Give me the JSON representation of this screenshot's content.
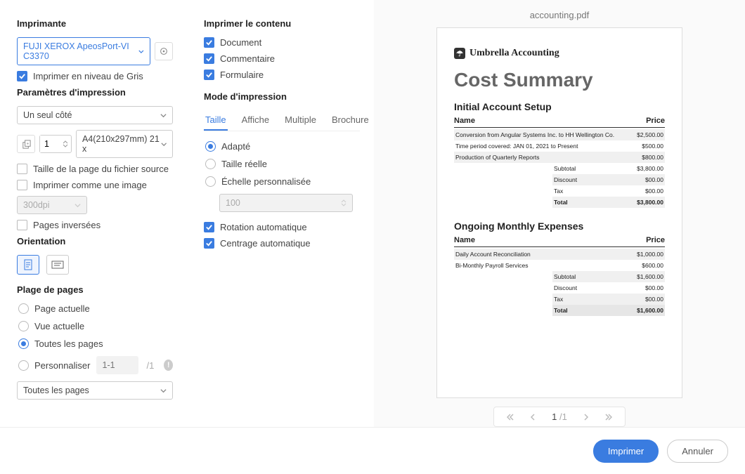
{
  "col1": {
    "printer_title": "Imprimante",
    "printer_value": "FUJI XEROX ApeosPort-VI C3370",
    "grayscale": "Imprimer en niveau de Gris",
    "settings_title": "Paramètres d'impression",
    "duplex_value": "Un seul côté",
    "copies_value": "1",
    "paper_value": "A4(210x297mm) 21 x",
    "source_page_size": "Taille de la page du fichier source",
    "print_as_image": "Imprimer comme une image",
    "dpi_value": "300dpi",
    "reverse_pages": "Pages inversées",
    "orientation_title": "Orientation",
    "range_title": "Plage de pages",
    "range_current_page": "Page actuelle",
    "range_current_view": "Vue actuelle",
    "range_all": "Toutes les pages",
    "range_custom": "Personnaliser",
    "range_custom_placeholder": "1-1",
    "range_total": "/1",
    "page_subset": "Toutes les pages"
  },
  "col2": {
    "content_title": "Imprimer le contenu",
    "opt_document": "Document",
    "opt_comment": "Commentaire",
    "opt_form": "Formulaire",
    "mode_title": "Mode d'impression",
    "tabs": {
      "size": "Taille",
      "poster": "Affiche",
      "multiple": "Multiple",
      "brochure": "Brochure"
    },
    "fit": "Adapté",
    "actual": "Taille réelle",
    "custom_scale": "Échelle personnalisée",
    "scale_value": "100",
    "auto_rotate": "Rotation automatique",
    "auto_center": "Centrage automatique"
  },
  "preview": {
    "filename": "accounting.pdf",
    "logo_text": "Umbrella Accounting",
    "h1": "Cost Summary",
    "sec1_title": "Initial Account Setup",
    "name_hdr": "Name",
    "price_hdr": "Price",
    "s1r1_name": "Conversion from Angular Systems Inc. to HH Wellington Co.",
    "s1r1_price": "$2,500.00",
    "s1r2_name": "Time period covered: JAN 01, 2021 to Present",
    "s1r2_price": "$500.00",
    "s1r3_name": "Production of Quarterly Reports",
    "s1r3_price": "$800.00",
    "s1_subtotal_l": "Subtotal",
    "s1_subtotal_v": "$3,800.00",
    "s1_discount_l": "Discount",
    "s1_discount_v": "$00.00",
    "s1_tax_l": "Tax",
    "s1_tax_v": "$00.00",
    "s1_total_l": "Total",
    "s1_total_v": "$3,800.00",
    "sec2_title": "Ongoing Monthly Expenses",
    "s2r1_name": "Daily Account Reconciliation",
    "s2r1_price": "$1,000.00",
    "s2r2_name": "Bi-Monthly Payroll Services",
    "s2r2_price": "$600.00",
    "s2_subtotal_l": "Subtotal",
    "s2_subtotal_v": "$1,600.00",
    "s2_discount_l": "Discount",
    "s2_discount_v": "$00.00",
    "s2_tax_l": "Tax",
    "s2_tax_v": "$00.00",
    "s2_total_l": "Total",
    "s2_total_v": "$1,600.00",
    "pager_current": "1",
    "pager_total": "/1"
  },
  "footer": {
    "print": "Imprimer",
    "cancel": "Annuler"
  }
}
